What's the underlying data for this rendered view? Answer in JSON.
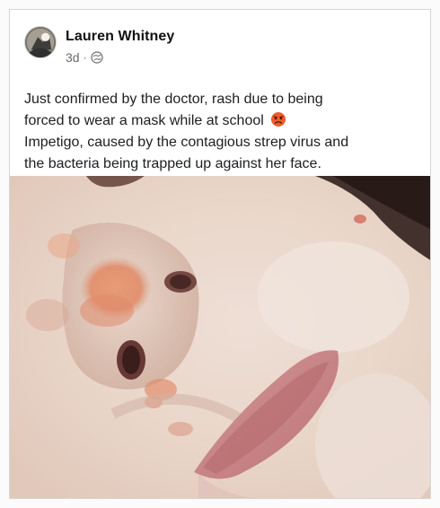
{
  "post": {
    "author": "Lauren Whitney",
    "time": "3d",
    "separator": "·",
    "visibility_icon": "globe-icon",
    "avatar_icon": "avatar-image",
    "text_lines": [
      "Just confirmed by the doctor, rash due to being",
      "forced to wear a mask while at school",
      "Impetigo, caused by the contagious strep virus and",
      "the bacteria being trapped up against her face."
    ],
    "emoji": "angry-face-emoji"
  },
  "colors": {
    "text": "#1c1e21",
    "meta": "#6b6b6b",
    "border": "#d6d6d6"
  }
}
